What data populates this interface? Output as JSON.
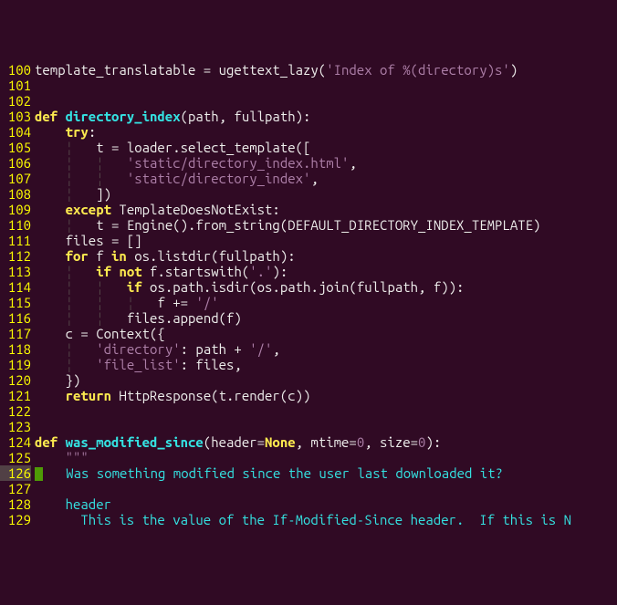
{
  "lines": [
    {
      "n": "100",
      "indent": "",
      "cursor": false,
      "tokens": [
        {
          "c": "id",
          "t": "template_translatable = ugettext_lazy("
        },
        {
          "c": "str",
          "t": "'Index of %(directory)s'"
        },
        {
          "c": "id",
          "t": ")"
        }
      ]
    },
    {
      "n": "101",
      "indent": "",
      "cursor": false,
      "tokens": []
    },
    {
      "n": "102",
      "indent": "",
      "cursor": false,
      "tokens": []
    },
    {
      "n": "103",
      "indent": "",
      "cursor": false,
      "tokens": [
        {
          "c": "kw",
          "t": "def"
        },
        {
          "c": "id",
          "t": " "
        },
        {
          "c": "fn",
          "t": "directory_index"
        },
        {
          "c": "id",
          "t": "(path, fullpath):"
        }
      ]
    },
    {
      "n": "104",
      "indent": "    ",
      "cursor": false,
      "tokens": [
        {
          "c": "kw",
          "t": "try"
        },
        {
          "c": "id",
          "t": ":"
        }
      ]
    },
    {
      "n": "105",
      "indent": "    |   ",
      "cursor": false,
      "tokens": [
        {
          "c": "id",
          "t": "t = loader.select_template(["
        }
      ]
    },
    {
      "n": "106",
      "indent": "    |   |   ",
      "cursor": false,
      "tokens": [
        {
          "c": "str",
          "t": "'static/directory_index.html'"
        },
        {
          "c": "id",
          "t": ","
        }
      ]
    },
    {
      "n": "107",
      "indent": "    |   |   ",
      "cursor": false,
      "tokens": [
        {
          "c": "str",
          "t": "'static/directory_index'"
        },
        {
          "c": "id",
          "t": ","
        }
      ]
    },
    {
      "n": "108",
      "indent": "    |   ",
      "cursor": false,
      "tokens": [
        {
          "c": "id",
          "t": "])"
        }
      ]
    },
    {
      "n": "109",
      "indent": "    ",
      "cursor": false,
      "tokens": [
        {
          "c": "kw",
          "t": "except"
        },
        {
          "c": "id",
          "t": " TemplateDoesNotExist:"
        }
      ]
    },
    {
      "n": "110",
      "indent": "    |   ",
      "cursor": false,
      "tokens": [
        {
          "c": "id",
          "t": "t = Engine().from_string(DEFAULT_DIRECTORY_INDEX_TEMPLATE)"
        }
      ]
    },
    {
      "n": "111",
      "indent": "    ",
      "cursor": false,
      "tokens": [
        {
          "c": "id",
          "t": "files = []"
        }
      ]
    },
    {
      "n": "112",
      "indent": "    ",
      "cursor": false,
      "tokens": [
        {
          "c": "kw",
          "t": "for"
        },
        {
          "c": "id",
          "t": " f "
        },
        {
          "c": "kw",
          "t": "in"
        },
        {
          "c": "id",
          "t": " os.listdir(fullpath):"
        }
      ]
    },
    {
      "n": "113",
      "indent": "    |   ",
      "cursor": false,
      "tokens": [
        {
          "c": "kw",
          "t": "if"
        },
        {
          "c": "id",
          "t": " "
        },
        {
          "c": "kw",
          "t": "not"
        },
        {
          "c": "id",
          "t": " f.startswith("
        },
        {
          "c": "str",
          "t": "'.'"
        },
        {
          "c": "id",
          "t": "):"
        }
      ]
    },
    {
      "n": "114",
      "indent": "    |   |   ",
      "cursor": false,
      "tokens": [
        {
          "c": "kw",
          "t": "if"
        },
        {
          "c": "id",
          "t": " os.path.isdir(os.path.join(fullpath, f)):"
        }
      ]
    },
    {
      "n": "115",
      "indent": "    |   |   |   ",
      "cursor": false,
      "tokens": [
        {
          "c": "id",
          "t": "f += "
        },
        {
          "c": "str",
          "t": "'/'"
        }
      ]
    },
    {
      "n": "116",
      "indent": "    |   |   ",
      "cursor": false,
      "tokens": [
        {
          "c": "id",
          "t": "files.append(f)"
        }
      ]
    },
    {
      "n": "117",
      "indent": "    ",
      "cursor": false,
      "tokens": [
        {
          "c": "id",
          "t": "c = Context({"
        }
      ]
    },
    {
      "n": "118",
      "indent": "    |   ",
      "cursor": false,
      "tokens": [
        {
          "c": "str",
          "t": "'directory'"
        },
        {
          "c": "id",
          "t": ": path + "
        },
        {
          "c": "str",
          "t": "'/'"
        },
        {
          "c": "id",
          "t": ","
        }
      ]
    },
    {
      "n": "119",
      "indent": "    |   ",
      "cursor": false,
      "tokens": [
        {
          "c": "str",
          "t": "'file_list'"
        },
        {
          "c": "id",
          "t": ": files,"
        }
      ]
    },
    {
      "n": "120",
      "indent": "    ",
      "cursor": false,
      "tokens": [
        {
          "c": "id",
          "t": "})"
        }
      ]
    },
    {
      "n": "121",
      "indent": "    ",
      "cursor": false,
      "tokens": [
        {
          "c": "kw",
          "t": "return"
        },
        {
          "c": "id",
          "t": " HttpResponse(t.render(c))"
        }
      ]
    },
    {
      "n": "122",
      "indent": "",
      "cursor": false,
      "tokens": []
    },
    {
      "n": "123",
      "indent": "",
      "cursor": false,
      "tokens": []
    },
    {
      "n": "124",
      "indent": "",
      "cursor": false,
      "tokens": [
        {
          "c": "kw",
          "t": "def"
        },
        {
          "c": "id",
          "t": " "
        },
        {
          "c": "fn",
          "t": "was_modified_since"
        },
        {
          "c": "id",
          "t": "(header="
        },
        {
          "c": "none",
          "t": "None"
        },
        {
          "c": "id",
          "t": ", mtime="
        },
        {
          "c": "num",
          "t": "0"
        },
        {
          "c": "id",
          "t": ", size="
        },
        {
          "c": "num",
          "t": "0"
        },
        {
          "c": "id",
          "t": "):"
        }
      ]
    },
    {
      "n": "125",
      "indent": "    ",
      "cursor": false,
      "tokens": [
        {
          "c": "str",
          "t": "\"\"\""
        }
      ]
    },
    {
      "n": "126",
      "indent": "",
      "cursor": true,
      "tokens": [
        {
          "c": "cursor",
          "t": ""
        },
        {
          "c": "cmt",
          "t": "   Was something modified since the user last downloaded it?"
        }
      ]
    },
    {
      "n": "127",
      "indent": "",
      "cursor": false,
      "tokens": []
    },
    {
      "n": "128",
      "indent": "    ",
      "cursor": false,
      "tokens": [
        {
          "c": "cmt",
          "t": "header"
        }
      ]
    },
    {
      "n": "129",
      "indent": "      ",
      "cursor": false,
      "tokens": [
        {
          "c": "cmt",
          "t": "This is the value of the If-Modified-Since header.  If this is N"
        }
      ]
    }
  ]
}
